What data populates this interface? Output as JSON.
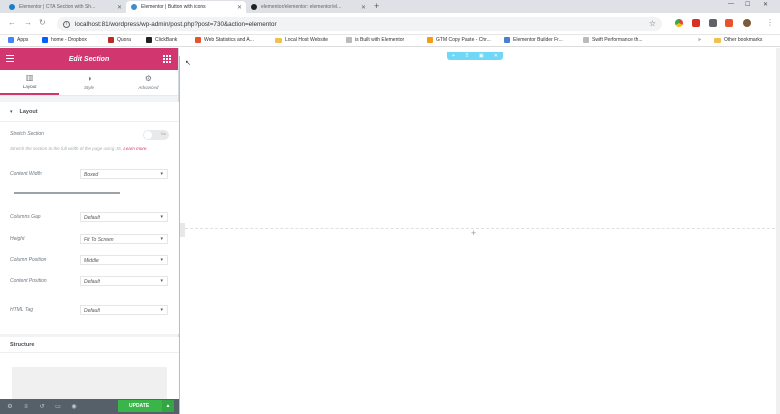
{
  "tabs": [
    {
      "title": "Elementor | CTA Section with Sh...",
      "color": "#1b7fc8"
    },
    {
      "title": "Elementor | Button with icons",
      "color": "#3c8fc8"
    },
    {
      "title": "elementor/elementor: elementor/el...",
      "color": "#222222"
    }
  ],
  "toolbar": {
    "url": "localhost:81/wordpress/wp-admin/post.php?post=730&action=elementor"
  },
  "bookmarks": [
    {
      "label": "Apps",
      "color": "#4285f4"
    },
    {
      "label": "home - Dropbox",
      "color": "#0061fe"
    },
    {
      "label": "Quora",
      "color": "#b92b27"
    },
    {
      "label": "ClickBank",
      "color": "#222222"
    },
    {
      "label": "Web Statistics and A...",
      "color": "#e8522d"
    },
    {
      "label": "Local Host Website",
      "color": "#f2c04f"
    },
    {
      "label": "is Built with Elementor",
      "color": "#888888"
    },
    {
      "label": "GTM Copy Paste - Chr...",
      "color": "#f29b1d"
    },
    {
      "label": "Elementor Builder Fr...",
      "color": "#4a7fd4"
    },
    {
      "label": "Swift Performance th...",
      "color": "#555555"
    },
    {
      "label": "Other bookmarks",
      "color": "#f2c04f"
    }
  ],
  "panel": {
    "title": "Edit Section",
    "tabs": [
      {
        "label": "Layout",
        "icon": "layout-icon"
      },
      {
        "label": "Style",
        "icon": "style-icon"
      },
      {
        "label": "Advanced",
        "icon": "gear-icon"
      }
    ],
    "layout_heading": "Layout",
    "stretch_label": "Stretch Section",
    "stretch_toggle": "No",
    "stretch_desc": "Stretch the section to the full width of the page using JS.",
    "learn_more": "Learn more.",
    "content_width_label": "Content Width",
    "content_width_value": "Boxed",
    "columns_gap_label": "Columns Gap",
    "columns_gap_value": "Default",
    "height_label": "Height",
    "height_value": "Fit To Screen",
    "column_position_label": "Column Position",
    "column_position_value": "Middle",
    "content_position_label": "Content Position",
    "content_position_value": "Default",
    "html_tag_label": "HTML Tag",
    "html_tag_value": "Default",
    "structure_heading": "Structure",
    "update_label": "UPDATE"
  },
  "preview": {
    "handle_icons": [
      "add-icon",
      "drag-icon",
      "columns-icon",
      "close-icon"
    ]
  }
}
